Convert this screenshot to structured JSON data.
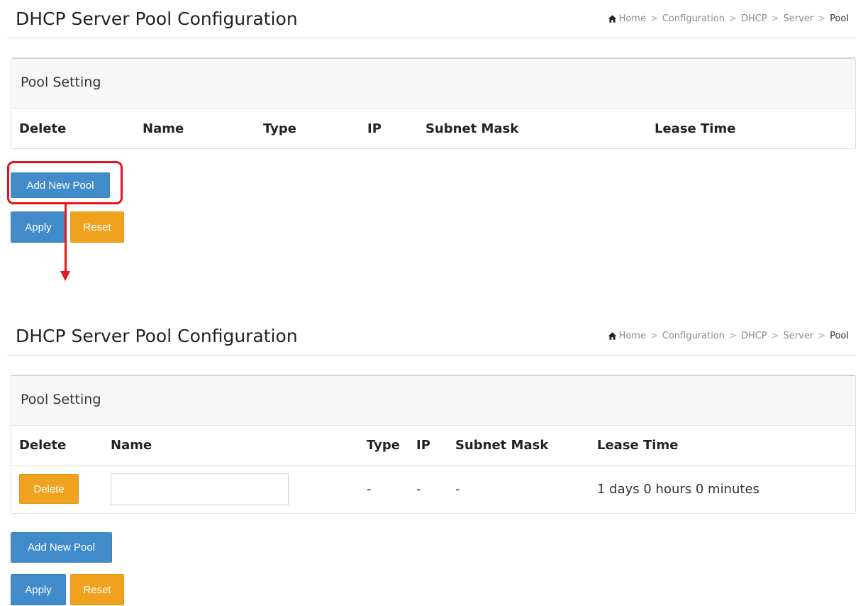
{
  "top_view": {
    "title": "DHCP Server Pool Configuration",
    "breadcrumb": [
      "Home",
      "Configuration",
      "DHCP",
      "Server",
      "Pool"
    ],
    "panel_title": "Pool Setting",
    "columns": [
      "Delete",
      "Name",
      "Type",
      "IP",
      "Subnet Mask",
      "Lease Time"
    ],
    "add_button": "Add New Pool",
    "apply_button": "Apply",
    "reset_button": "Reset"
  },
  "bottom_view": {
    "title": "DHCP Server Pool Configuration",
    "breadcrumb": [
      "Home",
      "Configuration",
      "DHCP",
      "Server",
      "Pool"
    ],
    "panel_title": "Pool Setting",
    "columns": [
      "Delete",
      "Name",
      "Type",
      "IP",
      "Subnet Mask",
      "Lease Time"
    ],
    "row": {
      "delete_button": "Delete",
      "name_value": "",
      "type": "-",
      "ip": "-",
      "subnet_mask": "-",
      "lease_time": "1 days 0 hours 0 minutes"
    },
    "add_button": "Add New Pool",
    "apply_button": "Apply",
    "reset_button": "Reset"
  },
  "colors": {
    "primary_button": "#428bca",
    "warning_button": "#f0a21f",
    "annotation": "#e8111a"
  },
  "icons": {
    "home": "home-icon",
    "separator": ">"
  }
}
